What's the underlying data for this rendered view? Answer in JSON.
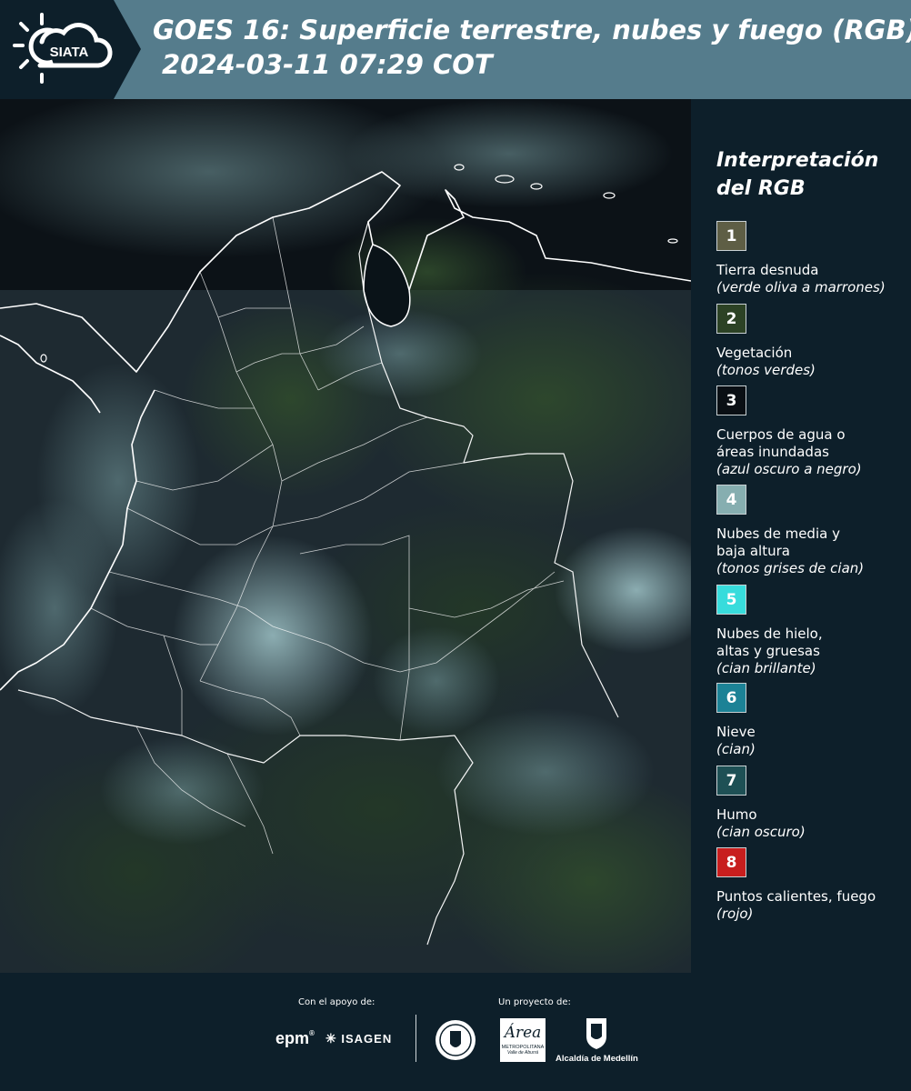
{
  "header": {
    "logo_text": "SIATA",
    "title_line1": "GOES 16: Superficie terrestre, nubes y fuego (RGB)",
    "title_line2": "2024-03-11 07:29 COT"
  },
  "legend": {
    "title": "Interpretación del RGB",
    "items": [
      {
        "num": "1",
        "color": "#5e5e45",
        "label": "Tierra desnuda",
        "desc": "(verde oliva a marrones)"
      },
      {
        "num": "2",
        "color": "#2c4225",
        "label": "Vegetación",
        "desc": "(tonos verdes)"
      },
      {
        "num": "3",
        "color": "#0a0f14",
        "label": "Cuerpos de agua o áreas inundadas",
        "desc": "(azul oscuro a negro)"
      },
      {
        "num": "4",
        "color": "#86aeb0",
        "label": "Nubes de media y baja altura",
        "desc": "(tonos grises de cian)"
      },
      {
        "num": "5",
        "color": "#37dcdc",
        "label": "Nubes de hielo, altas y gruesas",
        "desc": "(cian brillante)"
      },
      {
        "num": "6",
        "color": "#1c8296",
        "label": "Nieve",
        "desc": "(cian)"
      },
      {
        "num": "7",
        "color": "#1e5055",
        "label": "Humo",
        "desc": "(cian oscuro)"
      },
      {
        "num": "8",
        "color": "#c81e1e",
        "label": "Puntos calientes, fuego",
        "desc": "(rojo)"
      }
    ]
  },
  "footer": {
    "support_label": "Con el apoyo de:",
    "project_label": "Un proyecto de:",
    "sponsor_epm": "epm",
    "sponsor_isagen": "ISAGEN",
    "sponsor_area": "Área",
    "sponsor_area_sub": "METROPOLITANA",
    "sponsor_area_sub2": "Valle de Aburrá",
    "sponsor_alcaldia": "Alcaldía de Medellín"
  }
}
